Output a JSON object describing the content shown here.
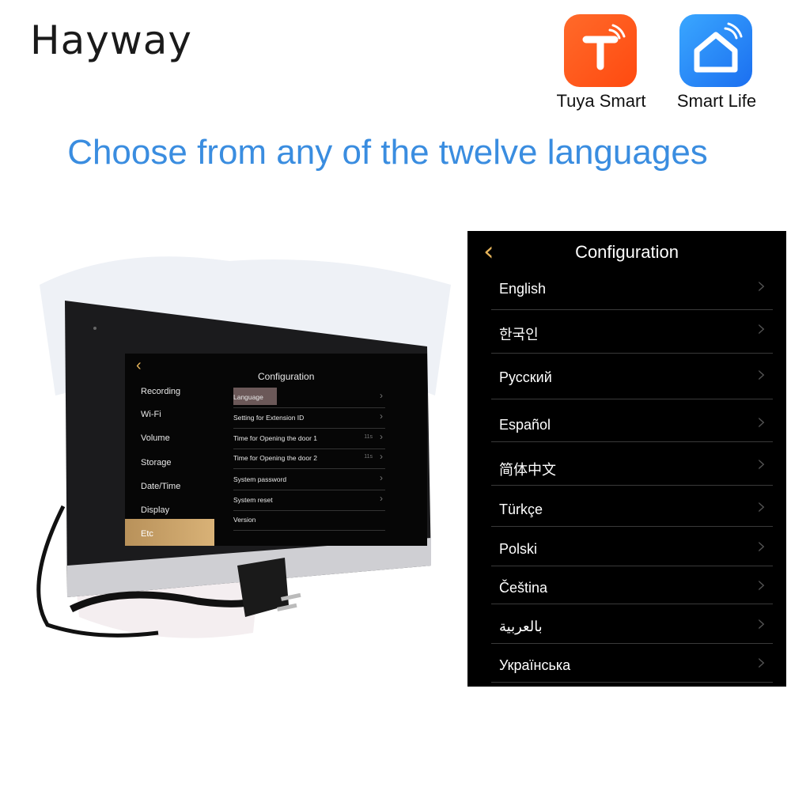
{
  "brand": "Hayway",
  "apps": [
    {
      "label": "Tuya Smart",
      "color": "#ff5a1e"
    },
    {
      "label": "Smart Life",
      "color": "#2a8af5"
    }
  ],
  "headline": "Choose from any of the twelve languages",
  "headline_color": "#3a8de0",
  "device_screen": {
    "title": "Configuration",
    "sidebar": [
      "Recording",
      "Wi-Fi",
      "Volume",
      "Storage",
      "Date/Time",
      "Display",
      "Etc"
    ],
    "selected_sidebar": "Etc",
    "options": [
      {
        "label": "Language",
        "value": ""
      },
      {
        "label": "Setting for Extension ID",
        "value": ""
      },
      {
        "label": "Time for Opening the door 1",
        "value": "11s"
      },
      {
        "label": "Time for Opening the door 2",
        "value": "11s"
      },
      {
        "label": "System  password",
        "value": ""
      },
      {
        "label": "System reset",
        "value": ""
      },
      {
        "label": "Version",
        "value": ""
      }
    ],
    "accent": "#d4ad72"
  },
  "language_panel": {
    "title": "Configuration",
    "languages": [
      "English",
      "한국인",
      "Русский",
      "Español",
      "简体中文",
      "Türkçe",
      "Polski",
      "Čeština",
      "بالعربية",
      "Українська"
    ]
  }
}
